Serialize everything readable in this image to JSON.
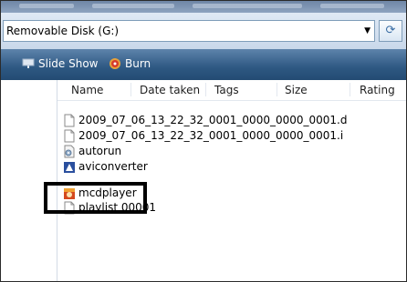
{
  "window": {
    "address": "Removable Disk (G:)"
  },
  "toolbar": {
    "slideshow_label": "Slide Show",
    "burn_label": "Burn"
  },
  "columns": {
    "name": "Name",
    "date_taken": "Date taken",
    "tags": "Tags",
    "size": "Size",
    "rating": "Rating"
  },
  "files": [
    {
      "name": "2009_07_06_13_22_32_0001_0000_0000_0001.d",
      "icon": "document-icon"
    },
    {
      "name": "2009_07_06_13_22_32_0001_0000_0000_0001.i",
      "icon": "document-icon"
    },
    {
      "name": "autorun",
      "icon": "settings-file-icon"
    },
    {
      "name": "aviconverter",
      "icon": "application-icon"
    },
    {
      "name": "mcdplayer",
      "icon": "player-app-icon"
    },
    {
      "name": "playlist 00001",
      "icon": "document-icon"
    }
  ],
  "colors": {
    "toolbar": "#2e5882",
    "address_border": "#7f9db9",
    "highlight": "#000000"
  }
}
